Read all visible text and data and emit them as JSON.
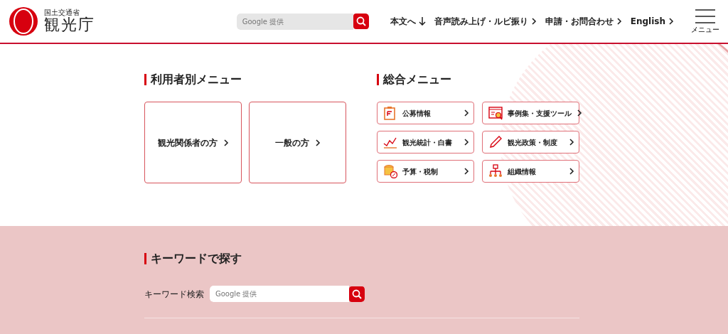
{
  "header": {
    "ministry": "国土交通省",
    "agency": "観光庁",
    "search": {
      "placeholder": "Google 提供"
    },
    "links": [
      {
        "label": "本文へ",
        "kind": "down"
      },
      {
        "label": "音声読み上げ・ルビ振り",
        "kind": "next"
      },
      {
        "label": "申請・お問合わせ",
        "kind": "next"
      },
      {
        "label": "English",
        "kind": "next"
      }
    ],
    "menu_label": "メニュー"
  },
  "user_menu": {
    "title": "利用者別メニュー",
    "items": [
      "観光関係者の方",
      "一般の方"
    ]
  },
  "general_menu": {
    "title": "総合メニュー",
    "items": [
      {
        "label": "公募情報",
        "kind": "clipboard"
      },
      {
        "label": "事例集・支援ツール",
        "kind": "search-doc"
      },
      {
        "label": "観光統計・白書",
        "kind": "chart"
      },
      {
        "label": "観光政策・制度",
        "kind": "pencil"
      },
      {
        "label": "予算・税制",
        "kind": "coins"
      },
      {
        "label": "組織情報",
        "kind": "org"
      }
    ]
  },
  "keyword": {
    "title": "キーワードで探す",
    "label": "キーワード検索",
    "search": {
      "placeholder": "Google 提供"
    }
  }
}
